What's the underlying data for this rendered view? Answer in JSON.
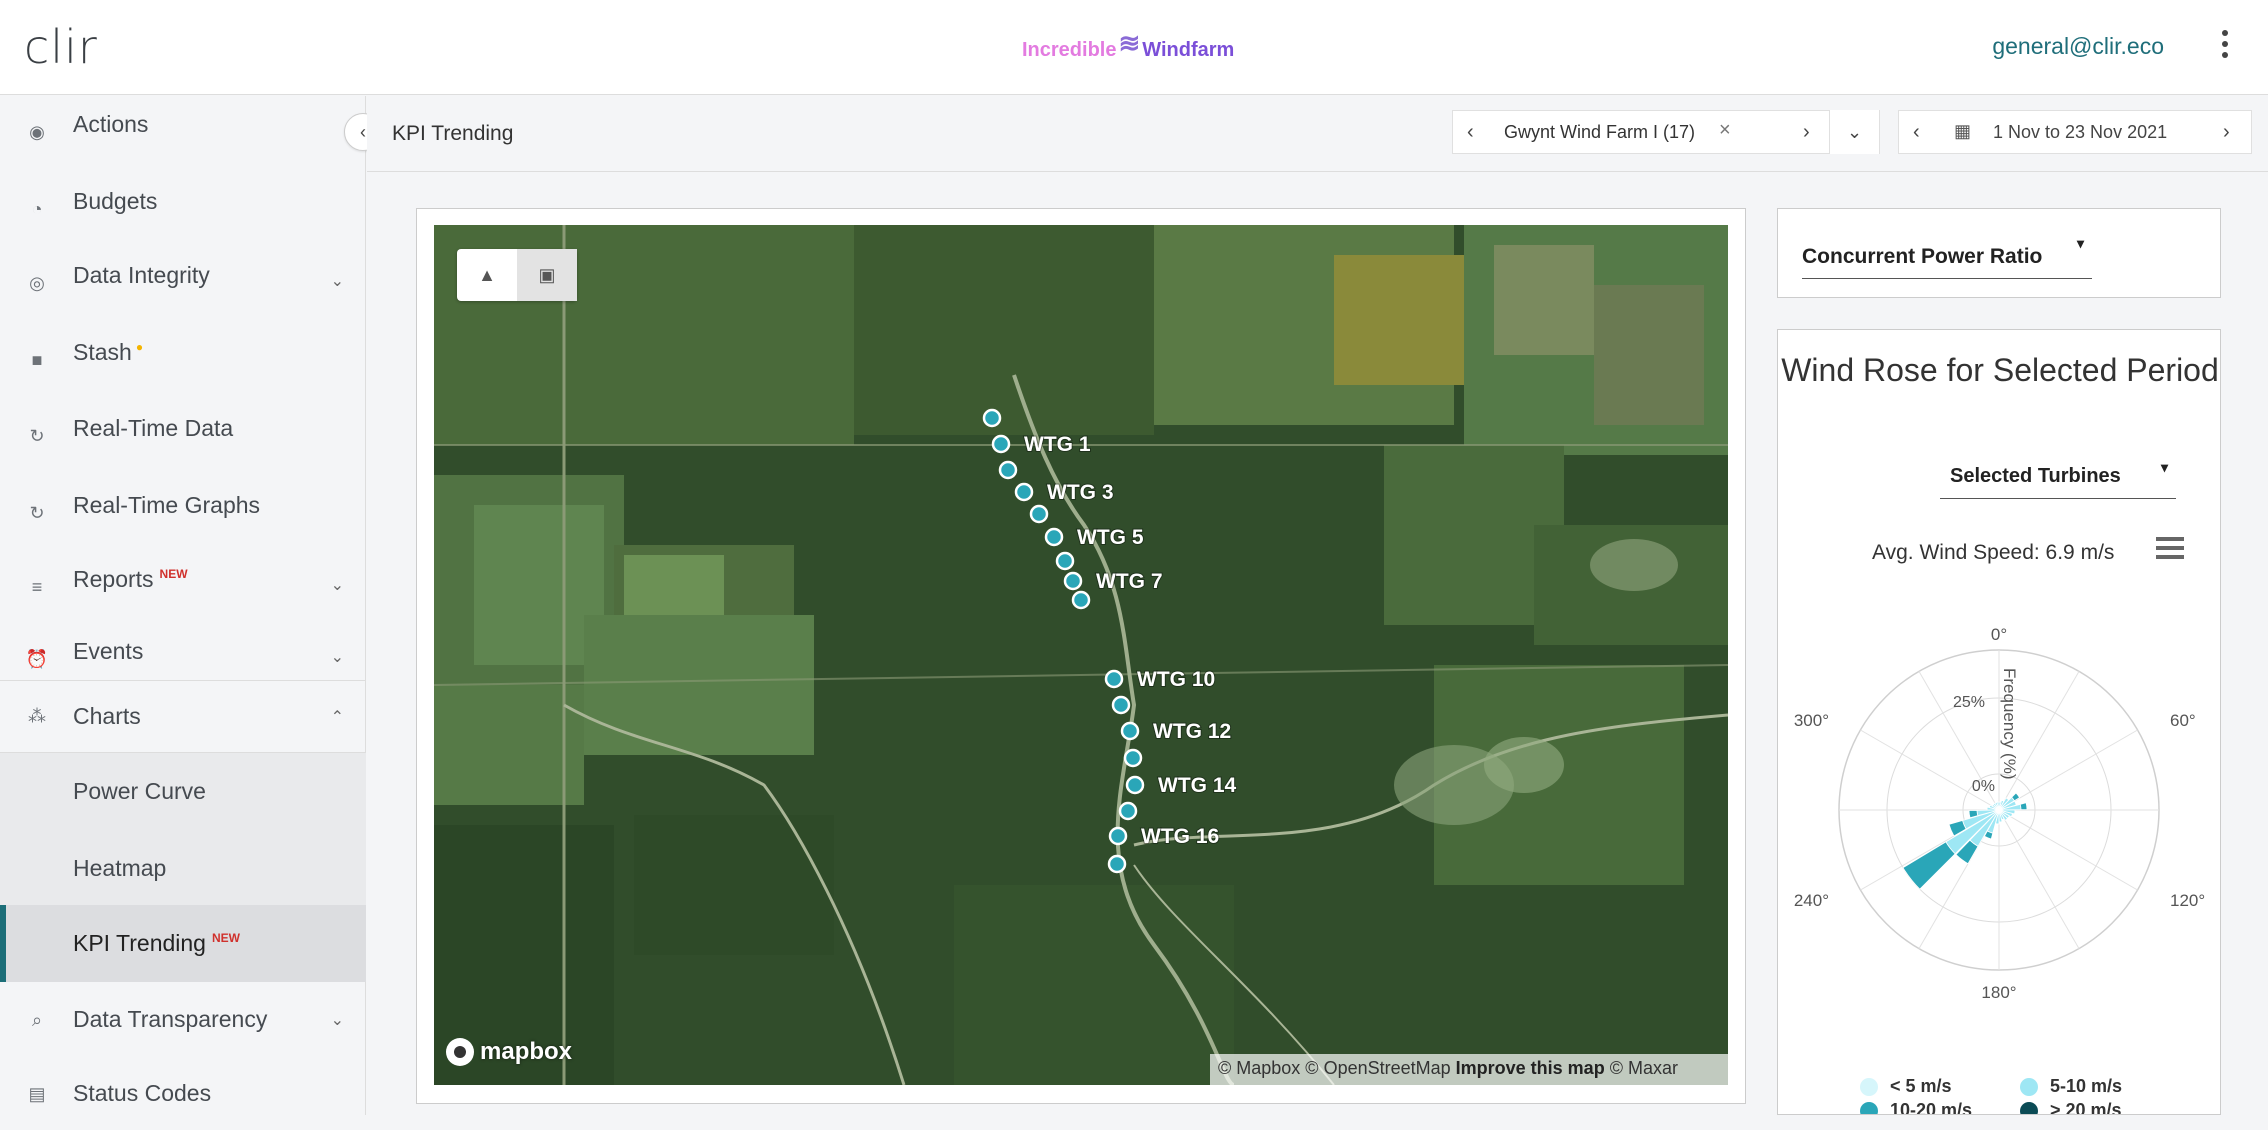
{
  "header": {
    "logo": "clir",
    "brand_part1": "Incredible",
    "brand_part2": "Windfarm",
    "user_email": "general@clir.eco"
  },
  "sidebar": {
    "items": [
      {
        "label": "Actions",
        "icon": "compass-icon"
      },
      {
        "label": "Budgets",
        "icon": "pie-icon"
      },
      {
        "label": "Data Integrity",
        "icon": "eye-icon"
      },
      {
        "label": "Stash",
        "icon": "briefcase-icon"
      },
      {
        "label": "Real-Time Data",
        "icon": "refresh-icon"
      },
      {
        "label": "Real-Time Graphs",
        "icon": "refresh-icon"
      },
      {
        "label": "Reports",
        "icon": "list-icon",
        "badge": "NEW"
      },
      {
        "label": "Events",
        "icon": "alarm-icon"
      },
      {
        "label": "Charts",
        "icon": "chart-icon"
      }
    ],
    "charts_sub": [
      {
        "label": "Power Curve"
      },
      {
        "label": "Heatmap"
      },
      {
        "label": "KPI Trending",
        "badge": "NEW"
      }
    ],
    "after": [
      {
        "label": "Data Transparency",
        "icon": "search-icon"
      },
      {
        "label": "Status Codes",
        "icon": "clipboard-icon"
      }
    ]
  },
  "page": {
    "title": "KPI Trending",
    "site": "Gwynt Wind Farm I (17)",
    "date_range": "1 Nov to 23 Nov 2021"
  },
  "map": {
    "turbine_labels": [
      "WTG 1",
      "WTG 3",
      "WTG 5",
      "WTG 7",
      "WTG 10",
      "WTG 12",
      "WTG 14",
      "WTG 16"
    ],
    "logo": "mapbox",
    "attribution_1": "© Mapbox © OpenStreetMap",
    "attribution_link": "Improve this map",
    "attribution_2": "© Maxar"
  },
  "kpi": {
    "selected": "Concurrent Power Ratio"
  },
  "windrose": {
    "title": "Wind Rose for Selected Period",
    "filter": "Selected Turbines",
    "avg_speed": "Avg. Wind Speed: 6.9 m/s",
    "angle_labels": [
      "0°",
      "60°",
      "120°",
      "180°",
      "240°",
      "300°"
    ],
    "radial_labels": [
      "25%",
      "0%"
    ],
    "radial_axis_title": "Frequency (%)",
    "legend": [
      {
        "label": "< 5 m/s",
        "color": "#d6f6fb"
      },
      {
        "label": "5-10 m/s",
        "color": "#9ee7f4"
      },
      {
        "label": "10-20 m/s",
        "color": "#2aa6b8"
      },
      {
        "label": "> 20 m/s",
        "color": "#0b4b55"
      }
    ]
  }
}
